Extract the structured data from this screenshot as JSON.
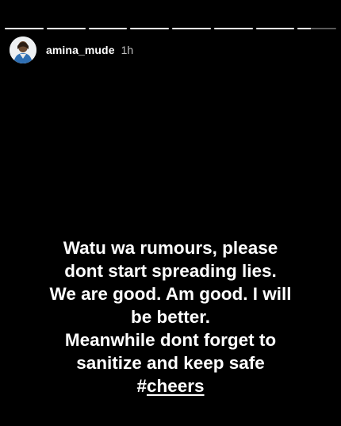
{
  "story": {
    "progress": [
      1,
      1,
      1,
      1,
      1,
      1,
      1,
      0.35
    ],
    "user": {
      "username": "amina_mude",
      "time_ago": "1h",
      "avatar_icon": "profile-avatar"
    },
    "caption_lines": [
      "Watu wa rumours, please",
      "dont start spreading lies.",
      "We are good. Am good. I will",
      "be better.",
      "Meanwhile dont forget to",
      "sanitize and keep safe"
    ],
    "hashtag_prefix": "#",
    "hashtag_word": "cheers"
  },
  "colors": {
    "background": "#000000",
    "text": "#ffffff",
    "progress_track": "#5a5a5a"
  }
}
